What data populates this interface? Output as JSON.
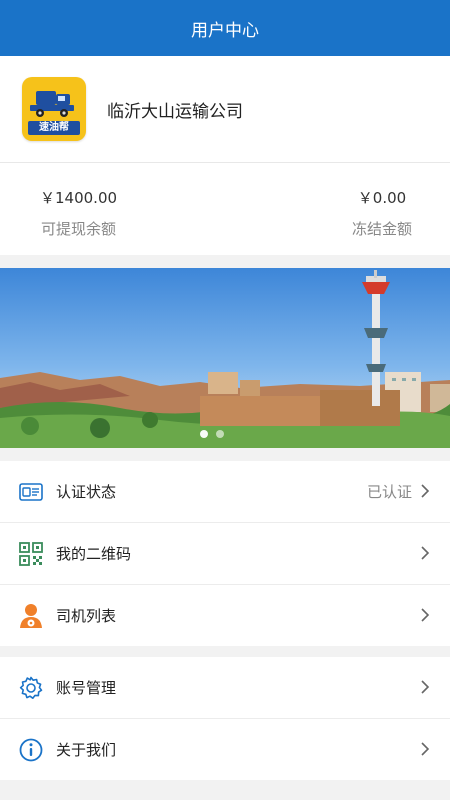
{
  "header": {
    "title": "用户中心"
  },
  "profile": {
    "company": "临沂大山运输公司",
    "logo_text": "速油帮"
  },
  "balances": {
    "withdrawable": {
      "amount": "￥1400.00",
      "label": "可提现余额"
    },
    "frozen": {
      "amount": "￥0.00",
      "label": "冻结金额"
    }
  },
  "banner": {
    "slides": 2,
    "active": 1
  },
  "menu": {
    "certification": {
      "label": "认证状态",
      "status": "已认证",
      "icon": "id-card-icon"
    },
    "qrcode": {
      "label": "我的二维码",
      "icon": "qr-code-icon"
    },
    "drivers": {
      "label": "司机列表",
      "icon": "driver-icon"
    },
    "account": {
      "label": "账号管理",
      "icon": "gear-icon"
    },
    "about": {
      "label": "关于我们",
      "icon": "info-icon"
    }
  },
  "colors": {
    "primary": "#1a73c8",
    "accent_orange": "#f0802a",
    "qr_green": "#3b8c5c",
    "icon_blue": "#1a73c8"
  }
}
